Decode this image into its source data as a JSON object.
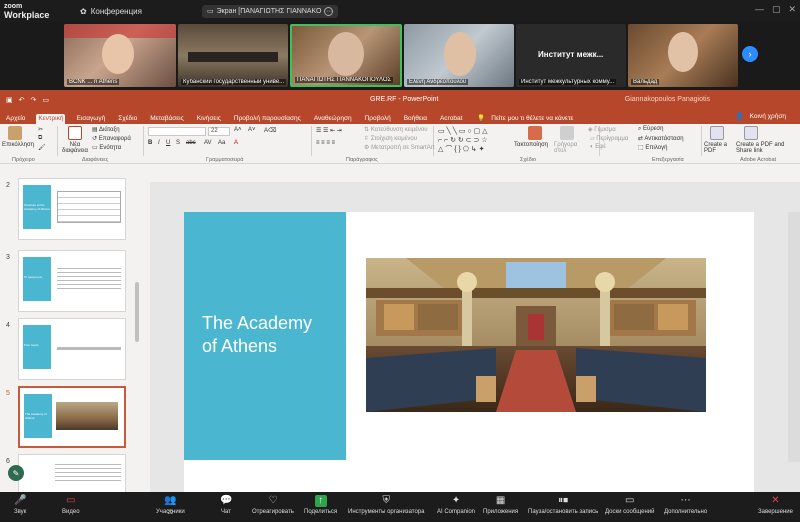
{
  "zoom": {
    "logo_line1": "zoom",
    "logo_line2": "Workplace",
    "conference_label": "Конференция",
    "share_banner": "Экран [ΠΑΝΑΓΙΩΤΗΣ ΓΙΑΝΝΑΚΟ",
    "participants": [
      {
        "name": "BCNK ... n Athens"
      },
      {
        "name": "Кубанский государственный униве..."
      },
      {
        "name": "ΠΑΝΑΓΙΩΤΗΣ ΓΙΑΝΝΑΚΟΠΟΥΛΟΣ"
      },
      {
        "name": "Ελένη Ανδρεοπούλου"
      },
      {
        "name": "Институт межкультурных комму...",
        "overlay": "Институт межк..."
      },
      {
        "name": "Вальдад"
      }
    ],
    "toolbar": [
      {
        "label": "Звук",
        "icon": "microphone-off-icon"
      },
      {
        "label": "Видео",
        "icon": "video-off-icon"
      },
      {
        "label": "Участники",
        "icon": "participants-icon",
        "badge": "22"
      },
      {
        "label": "Чат",
        "icon": "chat-icon"
      },
      {
        "label": "Отреагировать",
        "icon": "react-icon"
      },
      {
        "label": "Поделиться",
        "icon": "share-icon"
      },
      {
        "label": "Инструменты организатора",
        "icon": "host-tools-icon"
      },
      {
        "label": "AI Companion",
        "icon": "ai-companion-icon"
      },
      {
        "label": "Приложения",
        "icon": "apps-icon"
      },
      {
        "label": "Пауза/остановить запись",
        "icon": "pause-record-icon"
      },
      {
        "label": "Доски сообщений",
        "icon": "whiteboard-icon"
      },
      {
        "label": "Дополнительно",
        "icon": "more-icon"
      },
      {
        "label": "Завершение",
        "icon": "end-icon"
      }
    ]
  },
  "ppt": {
    "title": "GRE.RF - PowerPoint",
    "user": "Giannakopoulos Panagiotis",
    "tabs": [
      "Αρχείο",
      "Κεντρική",
      "Εισαγωγή",
      "Σχέδιο",
      "Μεταβάσεις",
      "Κινήσεις",
      "Προβολή παρουσίασης",
      "Αναθεώρηση",
      "Προβολή",
      "Βοήθεια",
      "Acrobat"
    ],
    "tell_me": "Πείτε μου τι θέλετε να κάνετε",
    "share": "Κοινή χρήση",
    "ribbon": {
      "paste": "Επικόλληση",
      "new_slide": "Νέα διαφάνεια",
      "layout": "Διάταξη",
      "reset": "Επαναφορά",
      "section": "Ενότητα",
      "font_size": "22",
      "convert_smartart": "Μετατροπή σε SmartArt",
      "text_direction": "Κατεύθυνση κειμένου",
      "align_text": "Στοίχιση κειμένου",
      "arrange": "Τακτοποίηση",
      "quick_styles": "Γρήγορα στυλ",
      "shape_fill": "Γέμισμα",
      "shape_outline": "Περίγραμμα",
      "effects": "Εφέ",
      "find": "Εύρεση",
      "replace": "Αντικατάσταση",
      "select": "Επιλογή",
      "create_pdf": "Create a PDF",
      "create_share": "Create a PDF and Share link",
      "groups": [
        "Πρόχειρο",
        "Διαφάνειες",
        "Γραμματοσειρά",
        "Παράγραφος",
        "Σχέδιο",
        "Επεξεργασία",
        "Adobe Acrobat"
      ]
    },
    "slides": [
      {
        "num": "2",
        "text": "Structure of the Academy of Athens"
      },
      {
        "num": "3",
        "text": "Το όραμα μας"
      },
      {
        "num": "4",
        "text": "Στον τομέα"
      },
      {
        "num": "5",
        "text": "The Academy of Athens"
      },
      {
        "num": "6",
        "text": ""
      }
    ],
    "main_slide": {
      "title": "The Academy of Athens"
    }
  }
}
